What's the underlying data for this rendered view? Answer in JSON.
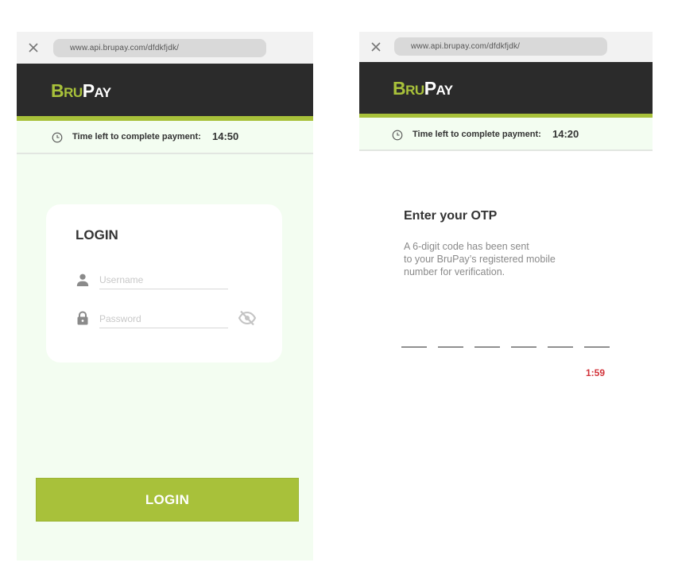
{
  "colors": {
    "brand_green": "#a8c13a",
    "header_dark": "#2b2b2b",
    "panel_mint": "#f3fdf1",
    "countdown_red": "#d2333a"
  },
  "login_screen": {
    "browser": {
      "url": "www.api.brupay.com/dfdkfjdk/",
      "close_icon": "close-icon"
    },
    "brand": {
      "part1_initial": "B",
      "part1_rest": "RU",
      "part2_initial": "P",
      "part2_rest": "AY"
    },
    "timer": {
      "icon": "clock-icon",
      "label": "Time left to complete payment:",
      "value": "14:50"
    },
    "card": {
      "title": "LOGIN",
      "username": {
        "icon": "person-icon",
        "placeholder": "Username",
        "value": ""
      },
      "password": {
        "icon": "lock-icon",
        "placeholder": "Password",
        "value": "",
        "toggle_icon": "eye-off-icon"
      }
    },
    "submit_label": "LOGIN"
  },
  "otp_screen": {
    "browser": {
      "url": "www.api.brupay.com/dfdkfjdk/",
      "close_icon": "close-icon"
    },
    "brand": {
      "part1_initial": "B",
      "part1_rest": "RU",
      "part2_initial": "P",
      "part2_rest": "AY"
    },
    "timer": {
      "icon": "clock-icon",
      "label": "Time left to complete payment:",
      "value": "14:20"
    },
    "title": "Enter your OTP",
    "description_lines": [
      "A 6-digit code has been sent",
      "to your BruPay’s registered mobile",
      "number for verification."
    ],
    "otp_digits": [
      "",
      "",
      "",
      "",
      "",
      ""
    ],
    "countdown": "1:59"
  }
}
